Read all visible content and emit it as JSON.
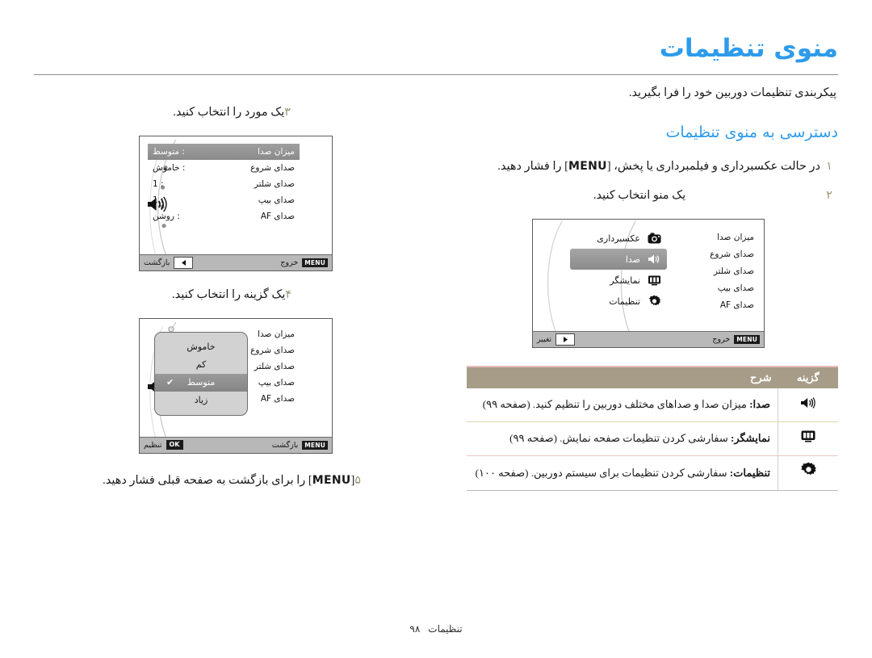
{
  "header": {
    "title": "منوی تنظیمات",
    "intro": "پیکربندی تنظیمات دوربین خود را فرا بگیرید."
  },
  "right_column": {
    "section_heading": "دسترسی به منوی تنظیمات",
    "steps": [
      {
        "num": "۱",
        "text_before": "در حالت عکسبرداری و فیلمبرداری یا پخش، [",
        "kbd": "MENU",
        "text_after": "] را فشار دهید."
      },
      {
        "num": "۲",
        "text": "یک منو انتخاب کنید."
      }
    ],
    "menu_screen": {
      "tabs": [
        {
          "label": "عکسبرداری",
          "icon": "camera-icon",
          "selected": false
        },
        {
          "label": "صدا",
          "icon": "speaker-icon",
          "selected": true
        },
        {
          "label": "نمایشگر",
          "icon": "display-icon",
          "selected": false
        },
        {
          "label": "تنظیمات",
          "icon": "gear-icon",
          "selected": false
        }
      ],
      "submenu": [
        "میزان صدا",
        "صدای شروع",
        "صدای شلتر",
        "صدای بیپ",
        "صدای AF"
      ],
      "bottom_left_label": "خروج",
      "bottom_left_badge": "MENU",
      "bottom_right_label": "تغییر",
      "bottom_right_arrow": "arrow-right-icon"
    },
    "table": {
      "columns": [
        "گزینه",
        "شرح"
      ],
      "rows": [
        {
          "icon": "speaker-icon",
          "name": "صدا:",
          "desc": " میزان صدا و صداهای مختلف دوربین را تنظیم کنید. (صفحه ۹۹)"
        },
        {
          "icon": "display-icon",
          "name": "نمایشگر:",
          "desc": " سفارشی کردن تنظیمات صفحه نمایش. (صفحه ۹۹)"
        },
        {
          "icon": "gear-icon",
          "name": "تنظیمات:",
          "desc": " سفارشی کردن تنظیمات برای سیستم دوربین. (صفحه ۱۰۰)"
        }
      ]
    }
  },
  "left_column": {
    "step3": {
      "num": "۳",
      "text": "یک مورد را انتخاب کنید."
    },
    "sound_screen": {
      "rows": [
        {
          "name": "میزان صدا",
          "value": "متوسط",
          "selected": true
        },
        {
          "name": "صدای شروع",
          "value": "خاموش",
          "selected": false
        },
        {
          "name": "صدای شلتر",
          "value": "1",
          "selected": false
        },
        {
          "name": "صدای بیپ",
          "value": "1",
          "selected": false
        },
        {
          "name": "صدای AF",
          "value": "روشن",
          "selected": false
        }
      ],
      "bottom_left_label": "خروج",
      "bottom_left_badge": "MENU",
      "bottom_right_label": "بازگشت",
      "bottom_right_arrow": "arrow-left-icon",
      "side_icon": "speaker-icon"
    },
    "step4": {
      "num": "۴",
      "text": "یک گزینه را انتخاب کنید."
    },
    "option_screen": {
      "rows": [
        {
          "name": "میزان صدا"
        },
        {
          "name": "صدای شروع"
        },
        {
          "name": "صدای شلتر"
        },
        {
          "name": "صدای بیپ"
        },
        {
          "name": "صدای AF"
        }
      ],
      "dropdown": [
        {
          "label": "خاموش",
          "selected": false
        },
        {
          "label": "کم",
          "selected": false
        },
        {
          "label": "متوسط",
          "selected": true
        },
        {
          "label": "زیاد",
          "selected": false
        }
      ],
      "bottom_left_label": "بازگشت",
      "bottom_left_badge": "MENU",
      "bottom_right_label": "تنظیم",
      "bottom_right_badge": "OK",
      "side_icon": "speaker-icon"
    },
    "step5": {
      "num": "۵",
      "text_before": "[",
      "kbd": "MENU",
      "text_after": "] را برای بازگشت به صفحه قبلی فشار دهید."
    }
  },
  "footer": {
    "label": "تنظیمات",
    "page": "۹۸"
  },
  "colors": {
    "accent_blue": "#2e9bea",
    "table_header": "#a79c88",
    "step_num": "#9a8f6d"
  }
}
